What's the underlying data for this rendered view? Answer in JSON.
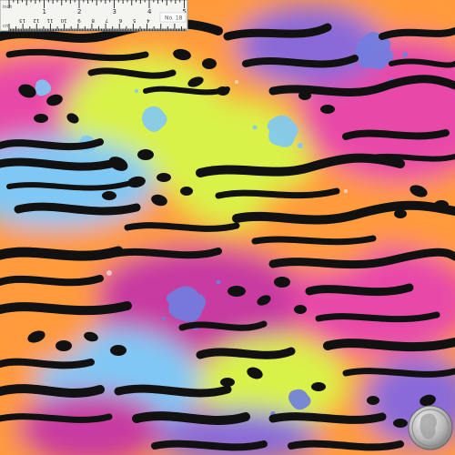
{
  "scene": {
    "description_tags": [
      "fabric-swatch",
      "animal-print",
      "neon-colors",
      "paint-splatter"
    ],
    "palette": {
      "orange": "#ff9a3c",
      "pink": "#e84aa8",
      "magenta": "#c83aa0",
      "yellow_green": "#d9f24a",
      "sky_blue": "#7fc8f5",
      "purple": "#8a6ad8",
      "periwinkle": "#6f7fe0",
      "black": "#111111"
    }
  },
  "ruler": {
    "inch_labels": [
      "1",
      "2",
      "3",
      "4",
      "5"
    ],
    "cm_labels": [
      "13",
      "12",
      "11",
      "10",
      "9",
      "8",
      "7",
      "6",
      "5",
      "4",
      "3",
      "2",
      "1"
    ],
    "left_text": "inch",
    "left_text_bottom": "cm",
    "tag": "No. 18"
  },
  "coin": {
    "label": "quarter-coin"
  }
}
